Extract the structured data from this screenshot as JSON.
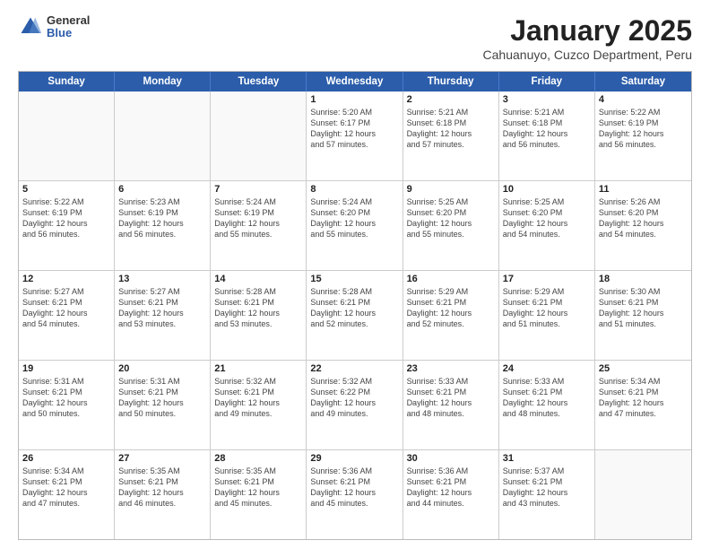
{
  "logo": {
    "general": "General",
    "blue": "Blue"
  },
  "title": "January 2025",
  "subtitle": "Cahuanuyo, Cuzco Department, Peru",
  "header_days": [
    "Sunday",
    "Monday",
    "Tuesday",
    "Wednesday",
    "Thursday",
    "Friday",
    "Saturday"
  ],
  "weeks": [
    [
      {
        "day": "",
        "info": ""
      },
      {
        "day": "",
        "info": ""
      },
      {
        "day": "",
        "info": ""
      },
      {
        "day": "1",
        "info": "Sunrise: 5:20 AM\nSunset: 6:17 PM\nDaylight: 12 hours\nand 57 minutes."
      },
      {
        "day": "2",
        "info": "Sunrise: 5:21 AM\nSunset: 6:18 PM\nDaylight: 12 hours\nand 57 minutes."
      },
      {
        "day": "3",
        "info": "Sunrise: 5:21 AM\nSunset: 6:18 PM\nDaylight: 12 hours\nand 56 minutes."
      },
      {
        "day": "4",
        "info": "Sunrise: 5:22 AM\nSunset: 6:19 PM\nDaylight: 12 hours\nand 56 minutes."
      }
    ],
    [
      {
        "day": "5",
        "info": "Sunrise: 5:22 AM\nSunset: 6:19 PM\nDaylight: 12 hours\nand 56 minutes."
      },
      {
        "day": "6",
        "info": "Sunrise: 5:23 AM\nSunset: 6:19 PM\nDaylight: 12 hours\nand 56 minutes."
      },
      {
        "day": "7",
        "info": "Sunrise: 5:24 AM\nSunset: 6:19 PM\nDaylight: 12 hours\nand 55 minutes."
      },
      {
        "day": "8",
        "info": "Sunrise: 5:24 AM\nSunset: 6:20 PM\nDaylight: 12 hours\nand 55 minutes."
      },
      {
        "day": "9",
        "info": "Sunrise: 5:25 AM\nSunset: 6:20 PM\nDaylight: 12 hours\nand 55 minutes."
      },
      {
        "day": "10",
        "info": "Sunrise: 5:25 AM\nSunset: 6:20 PM\nDaylight: 12 hours\nand 54 minutes."
      },
      {
        "day": "11",
        "info": "Sunrise: 5:26 AM\nSunset: 6:20 PM\nDaylight: 12 hours\nand 54 minutes."
      }
    ],
    [
      {
        "day": "12",
        "info": "Sunrise: 5:27 AM\nSunset: 6:21 PM\nDaylight: 12 hours\nand 54 minutes."
      },
      {
        "day": "13",
        "info": "Sunrise: 5:27 AM\nSunset: 6:21 PM\nDaylight: 12 hours\nand 53 minutes."
      },
      {
        "day": "14",
        "info": "Sunrise: 5:28 AM\nSunset: 6:21 PM\nDaylight: 12 hours\nand 53 minutes."
      },
      {
        "day": "15",
        "info": "Sunrise: 5:28 AM\nSunset: 6:21 PM\nDaylight: 12 hours\nand 52 minutes."
      },
      {
        "day": "16",
        "info": "Sunrise: 5:29 AM\nSunset: 6:21 PM\nDaylight: 12 hours\nand 52 minutes."
      },
      {
        "day": "17",
        "info": "Sunrise: 5:29 AM\nSunset: 6:21 PM\nDaylight: 12 hours\nand 51 minutes."
      },
      {
        "day": "18",
        "info": "Sunrise: 5:30 AM\nSunset: 6:21 PM\nDaylight: 12 hours\nand 51 minutes."
      }
    ],
    [
      {
        "day": "19",
        "info": "Sunrise: 5:31 AM\nSunset: 6:21 PM\nDaylight: 12 hours\nand 50 minutes."
      },
      {
        "day": "20",
        "info": "Sunrise: 5:31 AM\nSunset: 6:21 PM\nDaylight: 12 hours\nand 50 minutes."
      },
      {
        "day": "21",
        "info": "Sunrise: 5:32 AM\nSunset: 6:21 PM\nDaylight: 12 hours\nand 49 minutes."
      },
      {
        "day": "22",
        "info": "Sunrise: 5:32 AM\nSunset: 6:22 PM\nDaylight: 12 hours\nand 49 minutes."
      },
      {
        "day": "23",
        "info": "Sunrise: 5:33 AM\nSunset: 6:21 PM\nDaylight: 12 hours\nand 48 minutes."
      },
      {
        "day": "24",
        "info": "Sunrise: 5:33 AM\nSunset: 6:21 PM\nDaylight: 12 hours\nand 48 minutes."
      },
      {
        "day": "25",
        "info": "Sunrise: 5:34 AM\nSunset: 6:21 PM\nDaylight: 12 hours\nand 47 minutes."
      }
    ],
    [
      {
        "day": "26",
        "info": "Sunrise: 5:34 AM\nSunset: 6:21 PM\nDaylight: 12 hours\nand 47 minutes."
      },
      {
        "day": "27",
        "info": "Sunrise: 5:35 AM\nSunset: 6:21 PM\nDaylight: 12 hours\nand 46 minutes."
      },
      {
        "day": "28",
        "info": "Sunrise: 5:35 AM\nSunset: 6:21 PM\nDaylight: 12 hours\nand 45 minutes."
      },
      {
        "day": "29",
        "info": "Sunrise: 5:36 AM\nSunset: 6:21 PM\nDaylight: 12 hours\nand 45 minutes."
      },
      {
        "day": "30",
        "info": "Sunrise: 5:36 AM\nSunset: 6:21 PM\nDaylight: 12 hours\nand 44 minutes."
      },
      {
        "day": "31",
        "info": "Sunrise: 5:37 AM\nSunset: 6:21 PM\nDaylight: 12 hours\nand 43 minutes."
      },
      {
        "day": "",
        "info": ""
      }
    ]
  ]
}
